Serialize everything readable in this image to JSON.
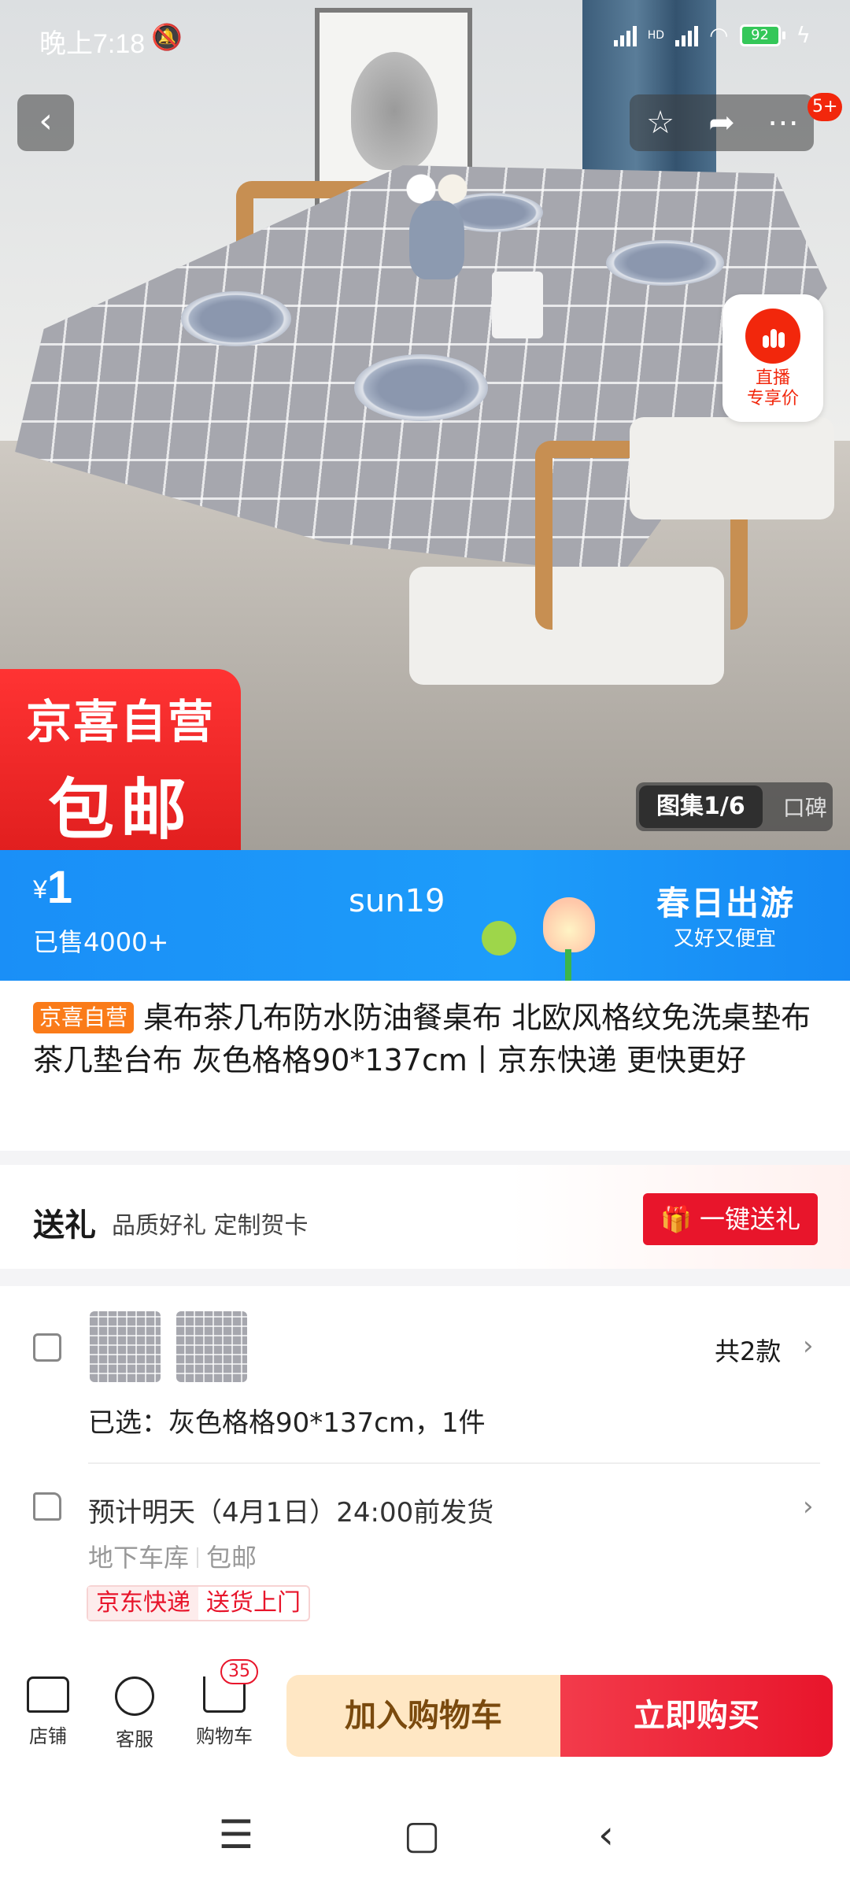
{
  "status_bar": {
    "time": "晚上7:18",
    "mute_icon": "bell-off-icon",
    "hd": "HD",
    "battery": "92"
  },
  "header": {
    "back_icon": "chevron-left-icon",
    "favorite_icon": "star-icon",
    "share_icon": "share-icon",
    "more_icon": "more-icon",
    "badge": "5+"
  },
  "live": {
    "label_line1": "直播",
    "label_line2": "专享价"
  },
  "promo": {
    "line1": "京喜自营",
    "line2": "包邮"
  },
  "gallery": {
    "tab_active": "图集1/6",
    "tab_other": "口碑"
  },
  "price_bar": {
    "currency": "¥",
    "price": "1",
    "sold": "已售4000+",
    "coupon": "sun19",
    "event_title": "春日出游",
    "event_sub": "又好又便宜"
  },
  "product": {
    "tag": "京喜自营",
    "title": "桌布茶几布防水防油餐桌布 北欧风格纹免洗桌垫布茶几垫台布 灰色格格90*137cm丨京东快递 更快更好"
  },
  "gift": {
    "title": "送礼",
    "subtitle": "品质好礼 定制贺卡",
    "button": "一键送礼"
  },
  "spec": {
    "count": "共2款",
    "selected": "已选：灰色格格90*137cm，1件"
  },
  "shipping": {
    "eta": "预计明天（4月1日）24:00前发货",
    "from": "地下车库",
    "free": "包邮",
    "tag_a": "京东快递",
    "tag_b": "送货上门"
  },
  "bottom_bar": {
    "store": "店铺",
    "service": "客服",
    "cart": "购物车",
    "cart_count": "35",
    "add_to_cart": "加入购物车",
    "buy_now": "立即购买"
  },
  "colors": {
    "accent_red": "#e8152b",
    "price_blue": "#1a8ff7",
    "tag_orange": "#fa7b19"
  }
}
